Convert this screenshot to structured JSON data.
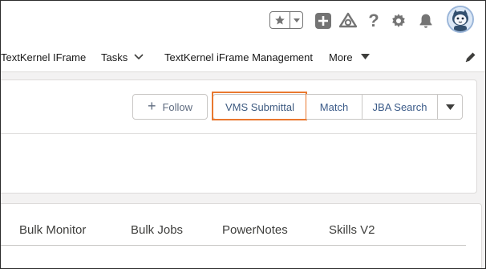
{
  "utility_bar": {
    "icons": [
      "star-icon",
      "chevron-down-icon",
      "add-icon",
      "trailhead-icon",
      "help-icon",
      "gear-icon",
      "bell-icon",
      "avatar-icon"
    ],
    "help_glyph": "?"
  },
  "nav": {
    "items": [
      {
        "label": "TextKernel IFrame"
      },
      {
        "label": "Tasks"
      },
      {
        "label": "TextKernel iFrame Management"
      },
      {
        "label": "More"
      }
    ]
  },
  "actions": {
    "follow_label": "Follow",
    "vms_label": "VMS Submittal",
    "match_label": "Match",
    "jba_label": "JBA Search"
  },
  "tabs": [
    {
      "label": "Bulk Monitor"
    },
    {
      "label": "Bulk Jobs"
    },
    {
      "label": "PowerNotes"
    },
    {
      "label": "Skills V2"
    }
  ],
  "colors": {
    "highlight_outline": "#e9782f",
    "button_text": "#3b5b89",
    "icon_gray": "#747474"
  }
}
